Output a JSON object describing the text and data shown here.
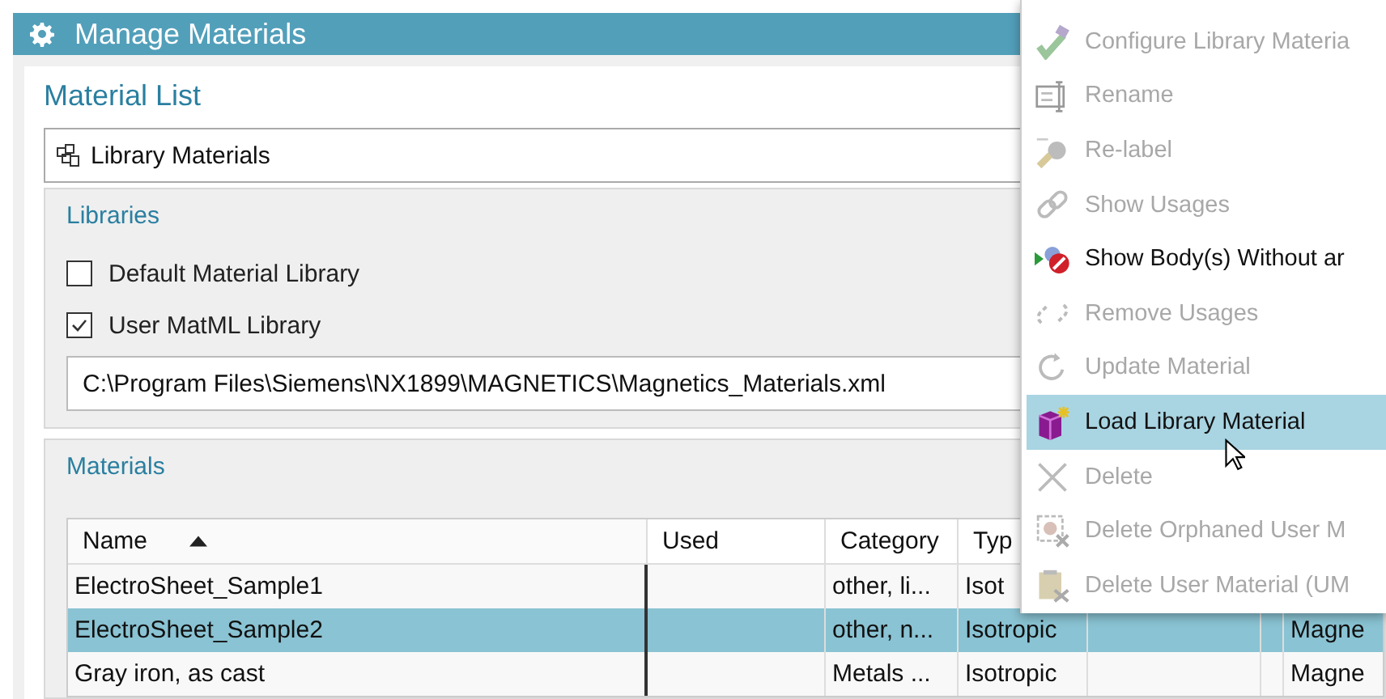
{
  "window": {
    "title": "Manage Materials"
  },
  "material_list": {
    "title": "Material List",
    "dropdown": {
      "value": "Library Materials"
    }
  },
  "libraries": {
    "title": "Libraries",
    "options": [
      {
        "label": "Default Material Library",
        "checked": false
      },
      {
        "label": "User MatML Library",
        "checked": true
      }
    ],
    "path": {
      "value": "C:\\Program Files\\Siemens\\NX1899\\MAGNETICS\\Magnetics_Materials.xml"
    }
  },
  "materials": {
    "title": "Materials",
    "table": {
      "columns": [
        {
          "label": "Name",
          "sorted": true
        },
        {
          "label": "Used",
          "sorted": false
        },
        {
          "label": "Category"
        },
        {
          "label": "Typ"
        }
      ],
      "rows": [
        {
          "cells": [
            "ElectroSheet_Sample1",
            "",
            "other, li...",
            "Isot",
            "",
            "",
            ""
          ],
          "selected": false
        },
        {
          "cells": [
            "ElectroSheet_Sample2",
            "",
            "other, n...",
            "Isotropic",
            "",
            "",
            "Magne"
          ],
          "selected": true
        },
        {
          "cells": [
            "Gray iron, as cast",
            "",
            "Metals ...",
            "Isotropic",
            "",
            "",
            "Magne"
          ],
          "selected": false
        }
      ]
    }
  },
  "context_menu": {
    "items": [
      {
        "label": "Configure Library Materia",
        "kind": "configure",
        "disabled": true,
        "selected": false
      },
      {
        "label": "Rename",
        "kind": "rename",
        "disabled": true,
        "selected": false
      },
      {
        "label": "Re-label",
        "kind": "relabel",
        "disabled": true,
        "selected": false
      },
      {
        "label": "Show Usages",
        "kind": "link",
        "disabled": true,
        "selected": false
      },
      {
        "label": "Show Body(s) Without ar",
        "kind": "showbody",
        "disabled": false,
        "selected": false
      },
      {
        "label": "Remove Usages",
        "kind": "unlink",
        "disabled": true,
        "selected": false
      },
      {
        "label": "Update Material",
        "kind": "update",
        "disabled": true,
        "selected": false
      },
      {
        "label": "Load Library Material",
        "kind": "load",
        "disabled": false,
        "selected": true
      },
      {
        "label": "Delete",
        "kind": "delete",
        "disabled": true,
        "selected": false
      },
      {
        "label": "Delete Orphaned User M",
        "kind": "orphan",
        "disabled": true,
        "selected": false
      },
      {
        "label": "Delete User Material (UM",
        "kind": "usermat",
        "disabled": true,
        "selected": false
      }
    ]
  }
}
